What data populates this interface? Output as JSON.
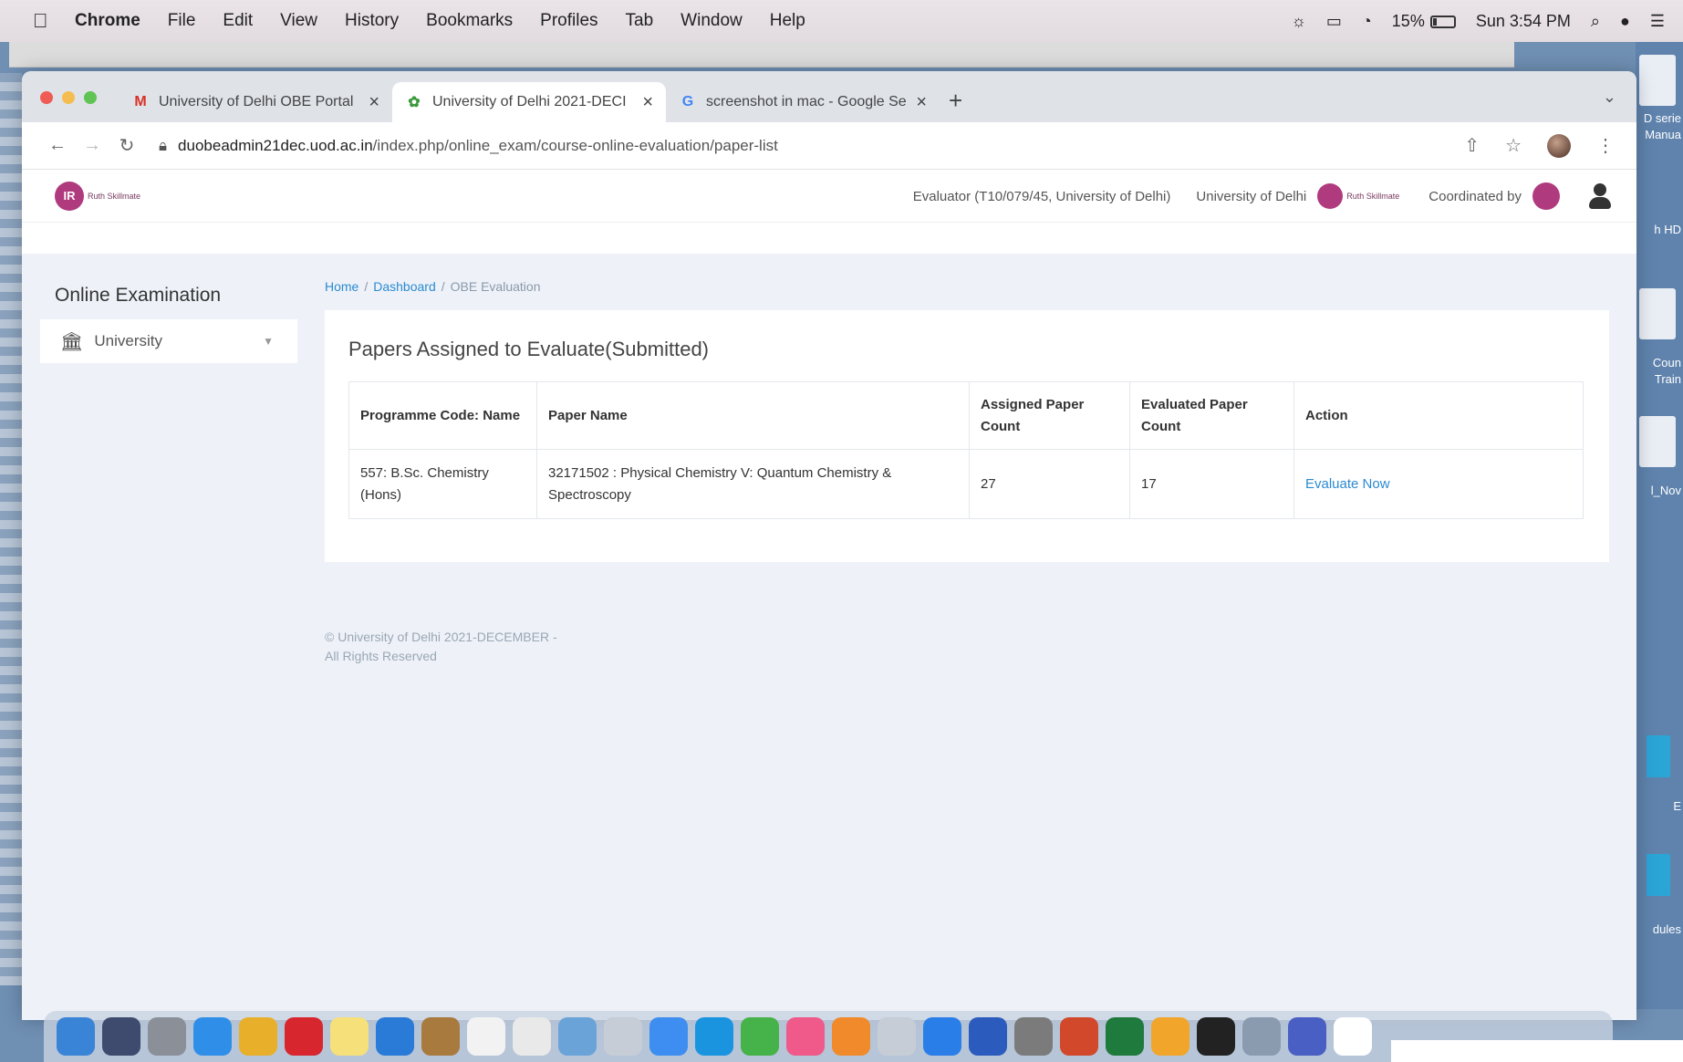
{
  "menubar": {
    "app": "Chrome",
    "items": [
      "File",
      "Edit",
      "View",
      "History",
      "Bookmarks",
      "Profiles",
      "Tab",
      "Window",
      "Help"
    ],
    "battery": "15%",
    "clock": "Sun 3:54 PM"
  },
  "browser": {
    "tabs": [
      {
        "favicon": "M",
        "title": "University of Delhi OBE Portal"
      },
      {
        "favicon": "✿",
        "title": "University of Delhi 2021-DECI"
      },
      {
        "favicon": "G",
        "title": "screenshot in mac - Google Se"
      }
    ],
    "new_tab": "+",
    "url_host": "duobeadmin21dec.uod.ac.in",
    "url_path": "/index.php/online_exam/course-online-evaluation/paper-list"
  },
  "header": {
    "logo_mark": "IR",
    "logo_text": "Ruth Skillmate",
    "evaluator": "Evaluator (T10/079/45, University of Delhi)",
    "university": "University of Delhi",
    "coordinated_by": "Coordinated by"
  },
  "sidebar": {
    "title": "Online Examination",
    "items": [
      {
        "label": "University"
      }
    ]
  },
  "breadcrumb": {
    "home": "Home",
    "dashboard": "Dashboard",
    "current": "OBE Evaluation"
  },
  "card": {
    "title": "Papers Assigned to Evaluate(Submitted)",
    "headers": [
      "Programme Code: Name",
      "Paper Name",
      "Assigned Paper Count",
      "Evaluated Paper Count",
      "Action"
    ],
    "rows": [
      {
        "programme": "557: B.Sc. Chemistry (Hons)",
        "paper": "32171502 : Physical Chemistry V: Quantum Chemistry & Spectroscopy",
        "assigned": "27",
        "evaluated": "17",
        "action": "Evaluate Now"
      }
    ]
  },
  "footer": {
    "line1": "© University of Delhi 2021-DECEMBER -",
    "line2": "All Rights Reserved"
  },
  "desktop": {
    "labels": [
      "D serie",
      "Manua",
      "h HD",
      "Coun",
      "Train",
      "l_Nov",
      "E",
      "dules"
    ]
  }
}
